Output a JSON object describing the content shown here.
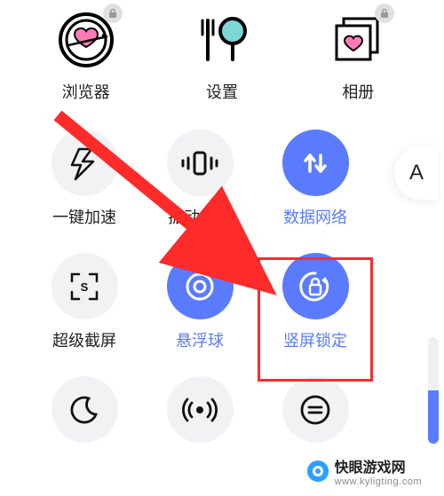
{
  "apps": [
    {
      "label": "浏览器",
      "icon": "browser-heart",
      "locked": true
    },
    {
      "label": "设置",
      "icon": "settings-cutlery",
      "locked": false
    },
    {
      "label": "相册",
      "icon": "gallery-heart",
      "locked": true
    }
  ],
  "toggles": [
    {
      "label": "一键加速",
      "icon": "boost",
      "active": false
    },
    {
      "label": "振动模式",
      "icon": "vibrate",
      "active": false
    },
    {
      "label": "数据网络",
      "icon": "data",
      "active": true
    },
    {
      "label": "超级截屏",
      "icon": "screenshot",
      "active": false
    },
    {
      "label": "悬浮球",
      "icon": "float-ball",
      "active": true
    },
    {
      "label": "竖屏锁定",
      "icon": "portrait-lock",
      "active": true,
      "highlighted": true
    },
    {
      "label": "",
      "icon": "moon",
      "active": false
    },
    {
      "label": "",
      "icon": "hotspot",
      "active": false
    },
    {
      "label": "",
      "icon": "more",
      "active": false
    }
  ],
  "font_toggle": "A",
  "watermark": {
    "brand": "快眼游戏网",
    "url": "www.kyligting.com"
  },
  "colors": {
    "accent": "#5b7bff",
    "highlight": "#ff2a2a"
  }
}
